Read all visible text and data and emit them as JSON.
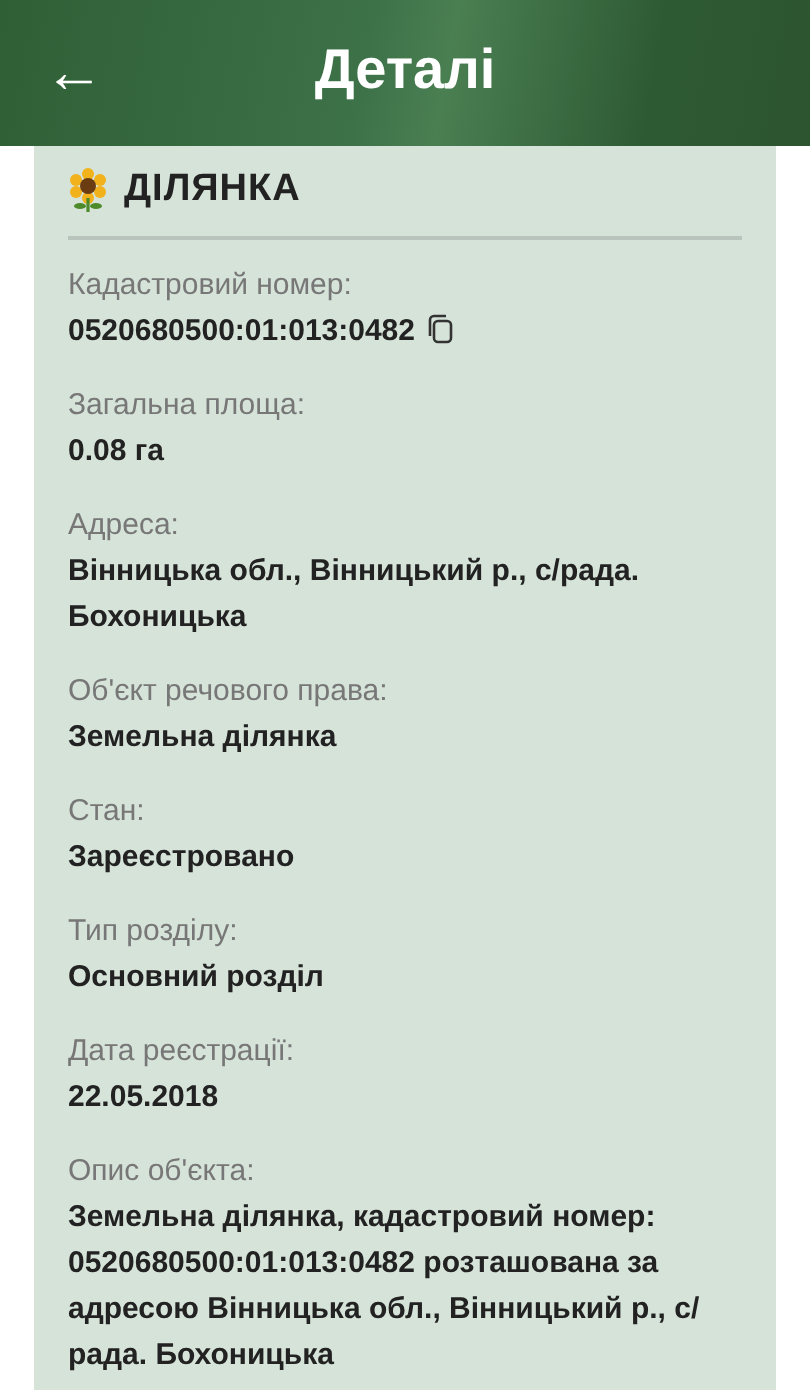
{
  "header": {
    "back_icon": "←",
    "title": "Деталі"
  },
  "section": {
    "title": "ДІЛЯНКА"
  },
  "fields": [
    {
      "label": "Кадастровий номер:",
      "value": "0520680500:01:013:0482",
      "copyable": true
    },
    {
      "label": "Загальна площа:",
      "value": "0.08 га"
    },
    {
      "label": "Адреса:",
      "value": "Вінницька обл., Вінницький р., с/рада. Бохоницька"
    },
    {
      "label": "Об'єкт речового права:",
      "value": "Земельна ділянка"
    },
    {
      "label": "Стан:",
      "value": "Зареєстровано"
    },
    {
      "label": "Тип розділу:",
      "value": "Основний розділ"
    },
    {
      "label": "Дата реєстрації:",
      "value": "22.05.2018"
    },
    {
      "label": "Опис об'єкта:",
      "value": "Земельна ділянка, кадастровий номер: 0520680500:01:013:0482 розташована за адресою Вінницька обл., Вінницький р., с/рада. Бохоницька"
    }
  ]
}
